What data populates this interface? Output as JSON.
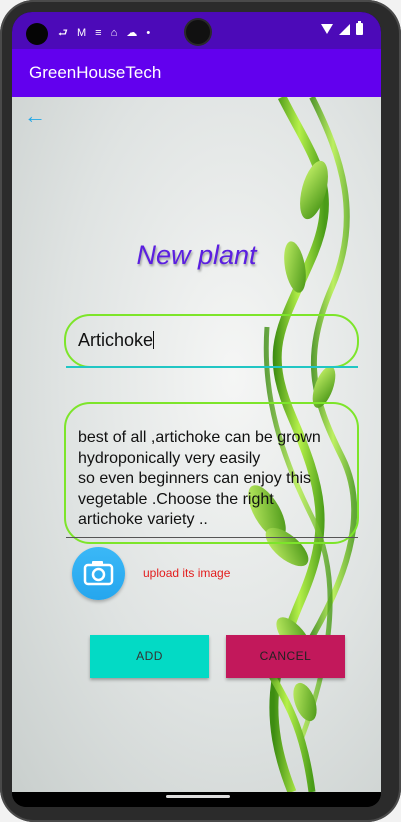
{
  "statusbar": {
    "left_icons": "⮐ M ≡ ⌂ ☁ •"
  },
  "appbar": {
    "title": "GreenHouseTech"
  },
  "nav": {
    "back_icon": "←"
  },
  "form": {
    "title": "New plant",
    "name_value": "Artichoke",
    "description_value": "best of all ,artichoke can be grown\nhydroponically very easily\nso even beginners can enjoy this\nvegetable .Choose the right\nartichoke variety ..",
    "upload_label": "upload its image",
    "add_label": "ADD",
    "cancel_label": "CANCEL"
  },
  "colors": {
    "appbar": "#6200ee",
    "statusbar": "#4c0ab8",
    "title": "#5b1fe0",
    "field_border": "#7de52a",
    "accent_underline": "#21c6c4",
    "add_button": "#03dac5",
    "cancel_button": "#c2185b",
    "upload_label": "#e31d1d",
    "camera_button": "#25a6ee"
  },
  "icons": {
    "back": "arrow-left-icon",
    "camera": "camera-icon"
  }
}
